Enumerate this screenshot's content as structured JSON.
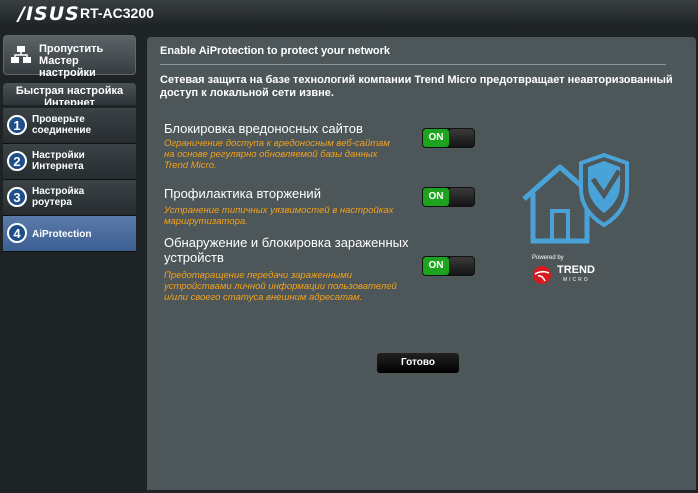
{
  "header": {
    "brand": "/ISUS",
    "model": "RT-AC3200"
  },
  "sidebar": {
    "skip_label": "Пропустить\nМастер настройки",
    "qis_title": "Быстрая настройка\nИнтернет",
    "steps": [
      {
        "num": "1",
        "label": "Проверьте\nсоединение"
      },
      {
        "num": "2",
        "label": "Настройки\nИнтернета"
      },
      {
        "num": "3",
        "label": "Настройка\nроутера"
      },
      {
        "num": "4",
        "label": "AiProtection"
      }
    ]
  },
  "main": {
    "title": "Enable AiProtection to protect your network",
    "intro": "Сетевая защита на базе технологий компании Trend Micro предотвращает неавторизованный доступ к локальной сети извне.",
    "features": [
      {
        "title": "Блокировка вредоносных сайтов",
        "desc": "Ограничение доступа к вредоносным веб-сайтам на основе регулярно обновляемой базы данных Trend Micro.",
        "toggle": "ON"
      },
      {
        "title": "Профилактика вторжений",
        "desc": "Устранение типичных уязвимостей в настройках маршрутизатора.",
        "toggle": "ON"
      },
      {
        "title": "Обнаружение и блокировка зараженных устройств",
        "desc": "Предотвращение передачи зараженными устройствами личной информации пользователей и/или своего статуса внешним адресатам.",
        "toggle": "ON"
      }
    ],
    "powered_by": "Powered by",
    "trend_text": "TREND",
    "trend_sub": "MICRO",
    "apply_label": "Готово"
  },
  "colors": {
    "accent_orange": "#f4a21b",
    "toggle_green": "#1ea31e",
    "panel": "#4d5659",
    "illustration_blue": "#4aa3d8",
    "trend_red": "#d71920"
  }
}
